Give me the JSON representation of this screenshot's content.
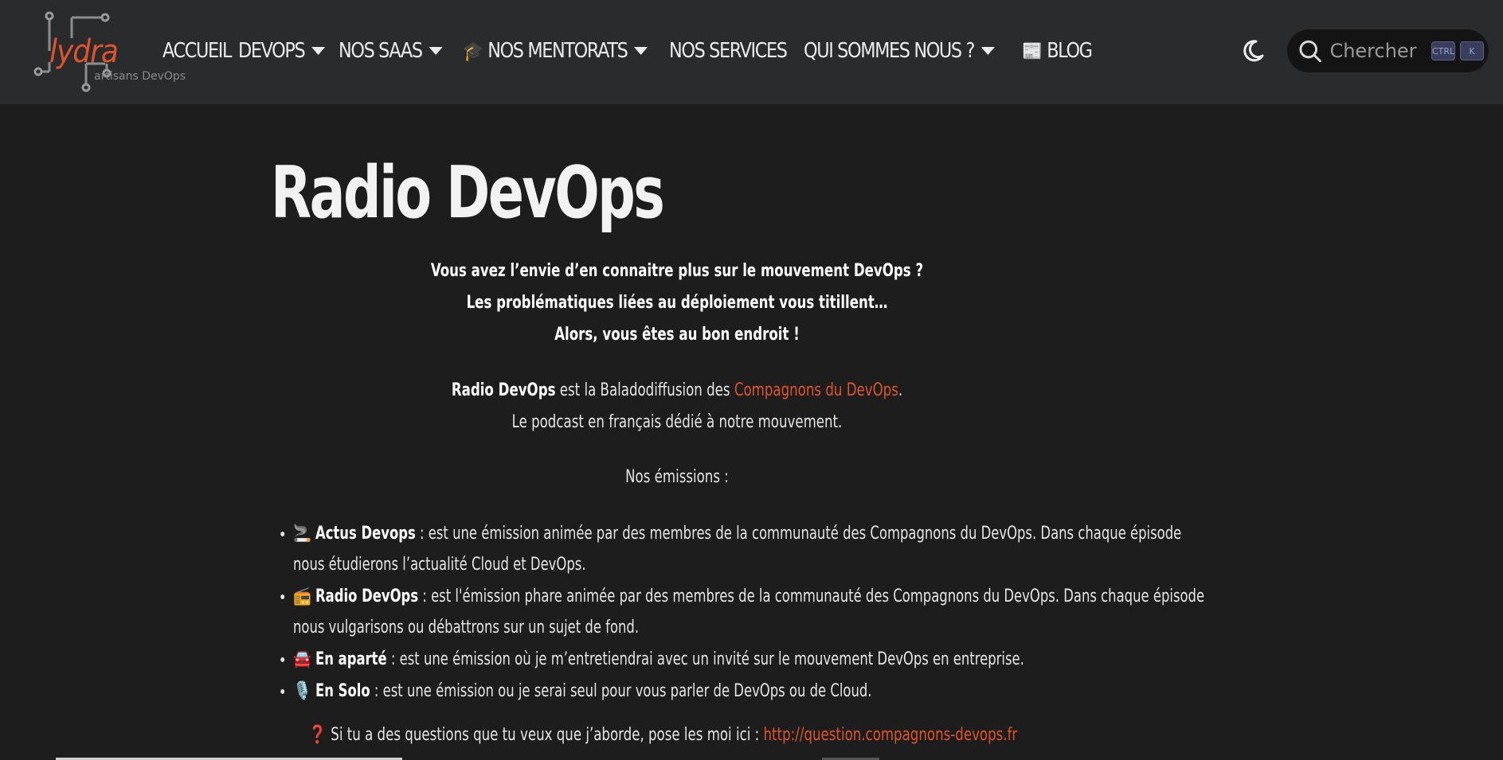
{
  "header": {
    "logo_text": "lydra",
    "logo_subtitle": "artisans DevOps",
    "nav": [
      {
        "label": "ACCUEIL",
        "has_dropdown": false,
        "emoji": ""
      },
      {
        "label": "DEVOPS",
        "has_dropdown": true,
        "emoji": ""
      },
      {
        "label": "NOS SAAS",
        "has_dropdown": true,
        "emoji": ""
      },
      {
        "label": "NOS MENTORATS",
        "has_dropdown": true,
        "emoji": "🎓"
      },
      {
        "label": "NOS SERVICES",
        "has_dropdown": false,
        "emoji": ""
      },
      {
        "label": "QUI SOMMES NOUS ?",
        "has_dropdown": true,
        "emoji": ""
      },
      {
        "label": "BLOG",
        "has_dropdown": false,
        "emoji": "📰"
      }
    ],
    "theme_icon": "moon-icon",
    "search": {
      "placeholder": "Chercher",
      "kbd_ctrl": "CTRL",
      "kbd_key": "K"
    }
  },
  "main": {
    "title": "Radio DevOps",
    "intro_lines": [
      "Vous avez l’envie d’en connaitre plus sur le mouvement DevOps ?",
      "Les problématiques liées au déploiement vous titillent…",
      "Alors, vous êtes au bon endroit !"
    ],
    "radio_bold": "Radio DevOps",
    "radio_text": " est la Baladodiffusion des ",
    "radio_link": "Compagnons du DevOps",
    "radio_end": ".",
    "podcast_line": "Le podcast en français dédié à notre mouvement.",
    "emissions_label": "Nos émissions :",
    "emissions": [
      {
        "emoji": "🚬",
        "title": "Actus Devops",
        "text": " : est une émission animée par des membres de la communauté des Compagnons du DevOps. Dans chaque épisode nous étudierons l’actualité Cloud et DevOps."
      },
      {
        "emoji": "📻",
        "title": "Radio DevOps",
        "text": " : est l'émission phare animée par des membres de la communauté des Compagnons du DevOps. Dans chaque épisode nous vulgarisons ou débattrons sur un sujet de fond."
      },
      {
        "emoji": "🚘",
        "title": "En aparté",
        "text": " : est une émission où je m’entretiendrai avec un invité sur le mouvement DevOps en entreprise."
      },
      {
        "emoji": "🎙️",
        "title": "En Solo",
        "text": " : est une émission ou je serai seul pour vous parler de DevOps ou de Cloud."
      }
    ],
    "question_emoji": "❓",
    "question_text": " Si tu a des questions que tu veux que j’aborde, pose les moi ici : ",
    "question_link": "http://question.compagnons-devops.fr"
  },
  "colors": {
    "accent": "#e0542a",
    "background": "#1d1d1d",
    "navbar": "#2a2b2d"
  }
}
